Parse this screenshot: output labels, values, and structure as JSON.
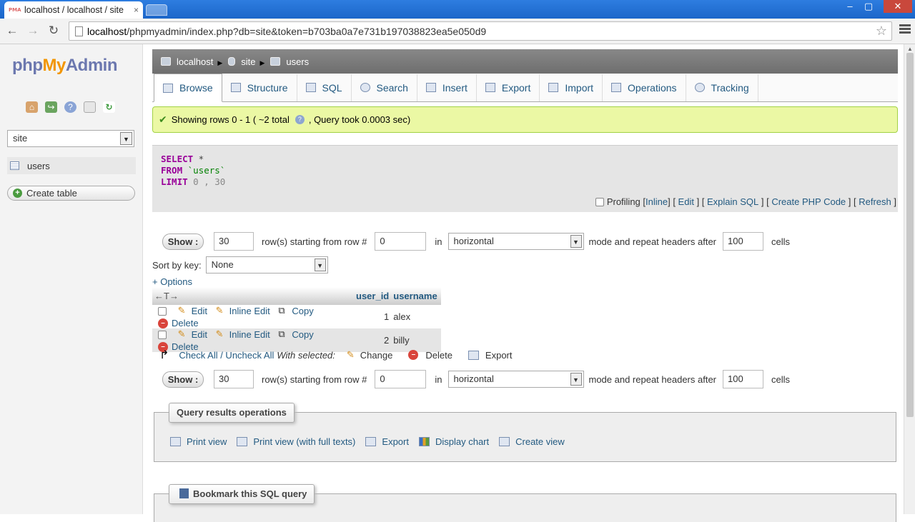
{
  "browser": {
    "tab_title": "localhost / localhost / site",
    "tab_close": "×",
    "favicon": "PMA",
    "url_host": "localhost",
    "url_path": "/phpmyadmin/index.php?db=site&token=b703ba0a7e731b197038823ea5e050d9",
    "back_glyph": "←",
    "forward_glyph": "→",
    "reload_glyph": "↻",
    "star_glyph": "☆",
    "minimize_glyph": "–",
    "maximize_glyph": "▢",
    "close_glyph": "✕"
  },
  "sidebar": {
    "logo_php": "php",
    "logo_my": "My",
    "logo_admin": "Admin",
    "db_selected": "site",
    "table_item": "users",
    "create_table": "Create table"
  },
  "breadcrumb": {
    "server": "localhost",
    "database": "site",
    "table": "users"
  },
  "tabs": [
    "Browse",
    "Structure",
    "SQL",
    "Search",
    "Insert",
    "Export",
    "Import",
    "Operations",
    "Tracking"
  ],
  "message": {
    "text1": "Showing rows 0 - 1 ( ~2 total",
    "text2": ", Query took 0.0003 sec)"
  },
  "sql": {
    "select_kw": "SELECT",
    "star": " *",
    "from_kw": "FROM",
    "table": " `users`",
    "limit_kw": "LIMIT",
    "limit_vals": " 0 , 30"
  },
  "sql_links": {
    "profiling": "Profiling",
    "inline": "Inline",
    "edit": "Edit",
    "explain": "Explain SQL",
    "create_php": "Create PHP Code",
    "refresh": "Refresh"
  },
  "nav": {
    "show_label": "Show :",
    "rows_value": "30",
    "rows_text": "row(s) starting from row #",
    "start_value": "0",
    "in_text": "in",
    "mode_value": "horizontal",
    "mode_text": "mode and repeat headers after",
    "headers_value": "100",
    "cells_text": "cells"
  },
  "sort": {
    "label": "Sort by key:",
    "value": "None"
  },
  "options_link": "+ Options",
  "results": {
    "columns": [
      "user_id",
      "username"
    ],
    "col_arrows": "←T→",
    "action_labels": {
      "edit": "Edit",
      "inline_edit": "Inline Edit",
      "copy": "Copy",
      "delete": "Delete"
    },
    "rows": [
      {
        "user_id": "1",
        "username": "alex"
      },
      {
        "user_id": "2",
        "username": "billy"
      }
    ]
  },
  "bulk": {
    "check_all": "Check All / Uncheck All",
    "with_selected": "With selected:",
    "change": "Change",
    "delete": "Delete",
    "export": "Export"
  },
  "query_ops": {
    "legend": "Query results operations",
    "links": [
      "Print view",
      "Print view (with full texts)",
      "Export",
      "Display chart",
      "Create view"
    ]
  },
  "bookmark": {
    "legend": "Bookmark this SQL query"
  }
}
